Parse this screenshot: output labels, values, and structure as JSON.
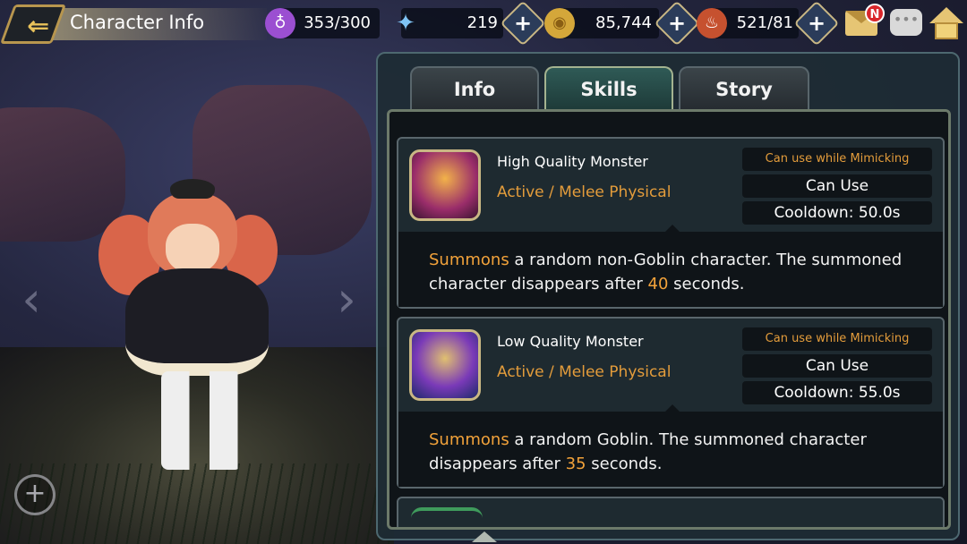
{
  "header": {
    "title": "Character Info"
  },
  "resources": [
    {
      "icon": "potion-icon",
      "value": "353/300",
      "color": "#9b4fd1"
    },
    {
      "icon": "crystal-icon",
      "value": "219",
      "color": "#4fa6e6"
    },
    {
      "icon": "gold-coin-icon",
      "value": "85,744",
      "color": "#d4a73a"
    },
    {
      "icon": "meat-icon",
      "value": "521/81",
      "color": "#c6512f"
    }
  ],
  "notifications": {
    "mail_badge": "N"
  },
  "tabs": [
    {
      "label": "Info",
      "active": false
    },
    {
      "label": "Skills",
      "active": true
    },
    {
      "label": "Story",
      "active": false
    }
  ],
  "skills": [
    {
      "name": "High Quality Monster",
      "type": "Active / Melee Physical",
      "mimic": "Can use while Mimicking",
      "usable": "Can Use",
      "cooldown": "Cooldown: 50.0s",
      "desc_highlight": "Summons",
      "desc_mid": " a random non-Goblin character. The summoned character disappears after ",
      "desc_num": "40",
      "desc_end": " seconds.",
      "icon": "monster-book-icon"
    },
    {
      "name": "Low Quality Monster",
      "type": "Active / Melee Physical",
      "mimic": "Can use while Mimicking",
      "usable": "Can Use",
      "cooldown": "Cooldown: 55.0s",
      "desc_highlight": "Summons",
      "desc_mid": " a random Goblin. The summoned character disappears after ",
      "desc_num": "35",
      "desc_end": " seconds.",
      "icon": "monster-scroll-icon"
    }
  ],
  "colors": {
    "accent_orange": "#e39c3b",
    "tab_active": "#2f5a56",
    "panel_bg": "#1e2a30"
  }
}
